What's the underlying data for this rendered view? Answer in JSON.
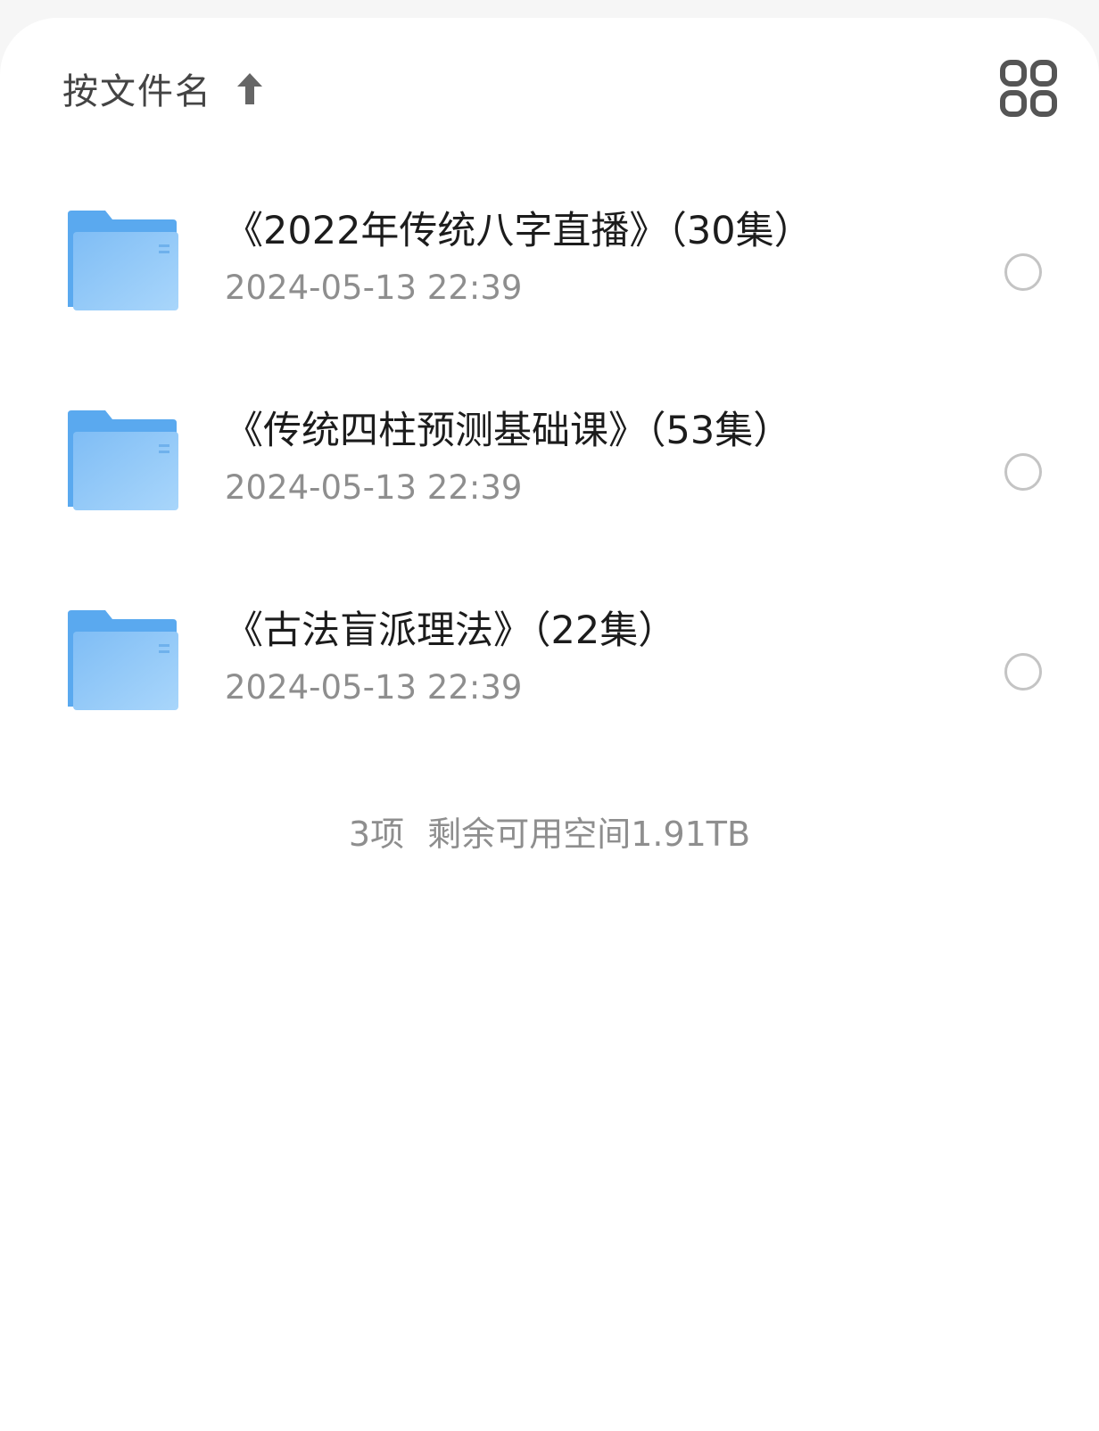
{
  "header": {
    "sort_label": "按文件名",
    "sort_direction_icon": "arrow-up-icon",
    "view_toggle_icon": "grid-view-icon"
  },
  "files": [
    {
      "name": "《2022年传统八字直播》（30集）",
      "date": "2024-05-13 22:39",
      "icon": "folder-icon",
      "selected": false
    },
    {
      "name": "《传统四柱预测基础课》（53集）",
      "date": "2024-05-13 22:39",
      "icon": "folder-icon",
      "selected": false
    },
    {
      "name": "《古法盲派理法》（22集）",
      "date": "2024-05-13 22:39",
      "icon": "folder-icon",
      "selected": false
    }
  ],
  "footer": {
    "item_count": "3项",
    "free_space": "剩余可用空间1.91TB"
  },
  "colors": {
    "folder_front": "#8cc4f7",
    "folder_back": "#5aa9ef",
    "text_primary": "#1c1c1c",
    "text_secondary": "#8e8e8e",
    "icon_gray": "#555555"
  }
}
